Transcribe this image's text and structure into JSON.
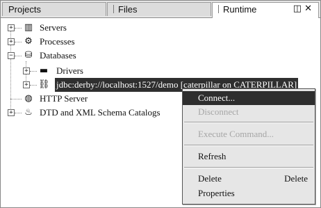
{
  "tabs": [
    {
      "label": "Projects",
      "active": false
    },
    {
      "label": "Files",
      "active": false
    },
    {
      "label": "Runtime",
      "active": true
    }
  ],
  "tab_controls": {
    "restore_glyph": "◫",
    "close_glyph": "✕"
  },
  "tree": {
    "servers": "Servers",
    "processes": "Processes",
    "databases": "Databases",
    "drivers": "Drivers",
    "connection": "jdbc:derby://localhost:1527/demo [caterpillar on CATERPILLAR]",
    "http_server": "HTTP Server",
    "dtd_catalogs": "DTD and XML Schema Catalogs"
  },
  "context_menu": {
    "connect": "Connect...",
    "disconnect": "Disconnect",
    "execute_command": "Execute Command...",
    "refresh": "Refresh",
    "delete": "Delete",
    "delete_shortcut": "Delete",
    "properties": "Properties"
  },
  "colors": {
    "highlight": "#2e2e2e",
    "disabled_text": "#a6a6a6",
    "menu_background": "#e6e6e6"
  }
}
